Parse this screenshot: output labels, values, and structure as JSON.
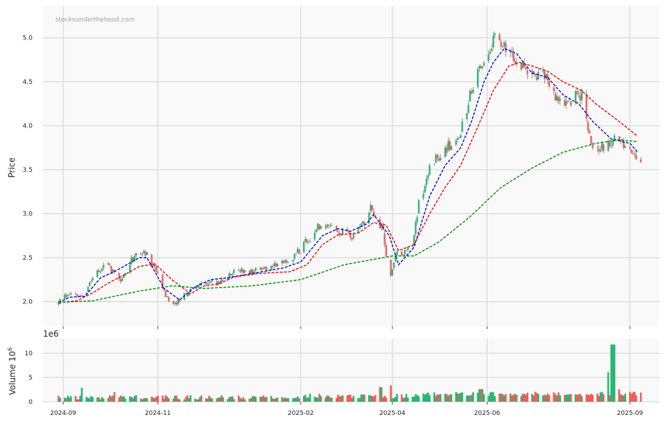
{
  "chart_data": {
    "type": "candlestick",
    "watermark": "stocksunderthehood.com",
    "price_panel": {
      "ylabel": "Price",
      "ylim": [
        1.72,
        5.36
      ],
      "yticks": [
        2.0,
        2.5,
        3.0,
        3.5,
        4.0,
        4.5,
        5.0
      ],
      "ytick_labels": [
        "2.0",
        "2.5",
        "3.0",
        "3.5",
        "4.0",
        "4.5",
        "5.0"
      ],
      "grid": true
    },
    "volume_panel": {
      "ylabel": "Volume",
      "ylabel_exp": "6",
      "offset_text": "1e6",
      "ylim": [
        0,
        13
      ],
      "yticks": [
        0,
        5,
        10
      ],
      "ytick_labels": [
        "0",
        "5",
        "10"
      ],
      "grid": true
    },
    "x_axis": {
      "range": [
        "2024-08-19",
        "2025-09-20"
      ],
      "ticks": [
        "2024-09-01",
        "2024-11-01",
        "2025-02-01",
        "2025-04-01",
        "2025-06-01",
        "2025-09-01"
      ],
      "tick_labels": [
        "2024-09",
        "2024-11",
        "2025-02",
        "2025-04",
        "2025-06",
        "2025-09"
      ]
    },
    "colors": {
      "up": "#2ab673",
      "down": "#f45b5b",
      "ma_short": "#0000dd",
      "ma_mid": "#ee0000",
      "ma_long": "#008800",
      "grid": "#d0d0d0",
      "panel_bg": "#f9f9f9"
    },
    "price_path": [
      [
        "2024-08-29",
        2.0
      ],
      [
        "2024-09-06",
        2.1
      ],
      [
        "2024-09-14",
        2.05
      ],
      [
        "2024-09-22",
        2.35
      ],
      [
        "2024-09-30",
        2.4
      ],
      [
        "2024-10-08",
        2.25
      ],
      [
        "2024-10-16",
        2.5
      ],
      [
        "2024-10-24",
        2.55
      ],
      [
        "2024-11-01",
        2.3
      ],
      [
        "2024-11-09",
        1.95
      ],
      [
        "2024-11-17",
        2.05
      ],
      [
        "2024-11-25",
        2.15
      ],
      [
        "2024-12-03",
        2.25
      ],
      [
        "2024-12-11",
        2.2
      ],
      [
        "2024-12-19",
        2.35
      ],
      [
        "2025-01-01",
        2.35
      ],
      [
        "2025-01-15",
        2.4
      ],
      [
        "2025-01-25",
        2.45
      ],
      [
        "2025-02-05",
        2.7
      ],
      [
        "2025-02-15",
        2.9
      ],
      [
        "2025-02-25",
        2.8
      ],
      [
        "2025-03-07",
        2.75
      ],
      [
        "2025-03-12",
        2.85
      ],
      [
        "2025-03-18",
        3.05
      ],
      [
        "2025-03-26",
        2.8
      ],
      [
        "2025-03-30",
        2.2
      ],
      [
        "2025-04-03",
        2.55
      ],
      [
        "2025-04-08",
        2.55
      ],
      [
        "2025-04-14",
        2.65
      ],
      [
        "2025-04-18",
        3.1
      ],
      [
        "2025-04-26",
        3.55
      ],
      [
        "2025-05-06",
        3.75
      ],
      [
        "2025-05-14",
        3.9
      ],
      [
        "2025-05-22",
        4.4
      ],
      [
        "2025-05-30",
        4.8
      ],
      [
        "2025-06-07",
        5.05
      ],
      [
        "2025-06-14",
        4.9
      ],
      [
        "2025-06-22",
        4.7
      ],
      [
        "2025-06-30",
        4.55
      ],
      [
        "2025-07-08",
        4.6
      ],
      [
        "2025-07-16",
        4.3
      ],
      [
        "2025-07-24",
        4.3
      ],
      [
        "2025-08-01",
        4.35
      ],
      [
        "2025-08-08",
        3.7
      ],
      [
        "2025-08-14",
        3.75
      ],
      [
        "2025-08-22",
        3.85
      ],
      [
        "2025-08-30",
        3.75
      ],
      [
        "2025-09-04",
        3.7
      ],
      [
        "2025-09-08",
        3.55
      ]
    ],
    "series": [
      {
        "key": "ma_short",
        "points": [
          [
            "2024-08-29",
            1.99
          ],
          [
            "2024-09-05",
            2.05
          ],
          [
            "2024-09-15",
            2.06
          ],
          [
            "2024-09-25",
            2.27
          ],
          [
            "2024-10-05",
            2.35
          ],
          [
            "2024-10-20",
            2.5
          ],
          [
            "2024-10-25",
            2.5
          ],
          [
            "2024-11-05",
            2.15
          ],
          [
            "2024-11-15",
            2.02
          ],
          [
            "2024-11-25",
            2.17
          ],
          [
            "2024-12-05",
            2.25
          ],
          [
            "2024-12-15",
            2.27
          ],
          [
            "2025-01-01",
            2.32
          ],
          [
            "2025-01-20",
            2.38
          ],
          [
            "2025-02-01",
            2.45
          ],
          [
            "2025-02-15",
            2.75
          ],
          [
            "2025-02-25",
            2.83
          ],
          [
            "2025-03-05",
            2.8
          ],
          [
            "2025-03-15",
            2.88
          ],
          [
            "2025-03-20",
            2.99
          ],
          [
            "2025-03-30",
            2.75
          ],
          [
            "2025-04-05",
            2.42
          ],
          [
            "2025-04-15",
            2.62
          ],
          [
            "2025-04-25",
            3.2
          ],
          [
            "2025-05-05",
            3.55
          ],
          [
            "2025-05-15",
            3.75
          ],
          [
            "2025-05-22",
            4.05
          ],
          [
            "2025-05-30",
            4.5
          ],
          [
            "2025-06-05",
            4.72
          ],
          [
            "2025-06-12",
            4.88
          ],
          [
            "2025-06-20",
            4.82
          ],
          [
            "2025-06-30",
            4.6
          ],
          [
            "2025-07-10",
            4.55
          ],
          [
            "2025-07-20",
            4.35
          ],
          [
            "2025-07-30",
            4.25
          ],
          [
            "2025-08-08",
            4.05
          ],
          [
            "2025-08-20",
            3.85
          ],
          [
            "2025-09-01",
            3.8
          ],
          [
            "2025-09-06",
            3.7
          ]
        ]
      },
      {
        "key": "ma_mid",
        "points": [
          [
            "2024-08-29",
            1.99
          ],
          [
            "2024-09-10",
            2.01
          ],
          [
            "2024-09-20",
            2.1
          ],
          [
            "2024-10-01",
            2.22
          ],
          [
            "2024-10-10",
            2.3
          ],
          [
            "2024-10-20",
            2.4
          ],
          [
            "2024-10-30",
            2.43
          ],
          [
            "2024-11-10",
            2.25
          ],
          [
            "2024-11-22",
            2.09
          ],
          [
            "2024-12-01",
            2.18
          ],
          [
            "2024-12-10",
            2.2
          ],
          [
            "2024-12-20",
            2.28
          ],
          [
            "2025-01-05",
            2.32
          ],
          [
            "2025-01-25",
            2.34
          ],
          [
            "2025-02-05",
            2.42
          ],
          [
            "2025-02-15",
            2.65
          ],
          [
            "2025-02-25",
            2.76
          ],
          [
            "2025-03-10",
            2.78
          ],
          [
            "2025-03-20",
            2.9
          ],
          [
            "2025-03-28",
            2.87
          ],
          [
            "2025-04-05",
            2.58
          ],
          [
            "2025-04-15",
            2.65
          ],
          [
            "2025-04-25",
            3.0
          ],
          [
            "2025-05-05",
            3.3
          ],
          [
            "2025-05-15",
            3.55
          ],
          [
            "2025-05-25",
            3.95
          ],
          [
            "2025-06-05",
            4.4
          ],
          [
            "2025-06-15",
            4.68
          ],
          [
            "2025-06-22",
            4.72
          ],
          [
            "2025-06-30",
            4.68
          ],
          [
            "2025-07-10",
            4.62
          ],
          [
            "2025-07-20",
            4.5
          ],
          [
            "2025-08-01",
            4.4
          ],
          [
            "2025-08-10",
            4.25
          ],
          [
            "2025-08-25",
            4.05
          ],
          [
            "2025-09-06",
            3.88
          ]
        ]
      },
      {
        "key": "ma_long",
        "points": [
          [
            "2024-08-29",
            1.99
          ],
          [
            "2024-09-20",
            2.01
          ],
          [
            "2024-10-20",
            2.12
          ],
          [
            "2024-11-10",
            2.18
          ],
          [
            "2024-12-01",
            2.15
          ],
          [
            "2025-01-01",
            2.18
          ],
          [
            "2025-02-01",
            2.25
          ],
          [
            "2025-03-01",
            2.42
          ],
          [
            "2025-04-01",
            2.52
          ],
          [
            "2025-04-15",
            2.52
          ],
          [
            "2025-05-01",
            2.68
          ],
          [
            "2025-05-20",
            2.95
          ],
          [
            "2025-06-10",
            3.3
          ],
          [
            "2025-06-30",
            3.52
          ],
          [
            "2025-07-20",
            3.7
          ],
          [
            "2025-08-10",
            3.8
          ],
          [
            "2025-08-25",
            3.84
          ],
          [
            "2025-09-06",
            3.82
          ]
        ]
      }
    ],
    "volume_spikes": [
      [
        "2024-09-14",
        2.9
      ],
      [
        "2024-10-05",
        2.0
      ],
      [
        "2025-03-24",
        3.0
      ],
      [
        "2025-03-30",
        3.4
      ],
      [
        "2025-05-28",
        2.6
      ],
      [
        "2025-08-17",
        6.1
      ],
      [
        "2025-08-21",
        11.8
      ],
      [
        "2025-08-24",
        2.6
      ]
    ]
  }
}
